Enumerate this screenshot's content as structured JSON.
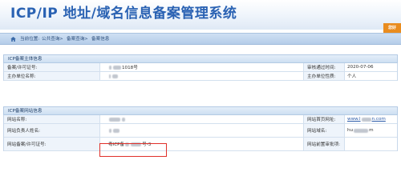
{
  "header": {
    "title": "ICP/IP 地址/域名信息备案管理系统",
    "greeting": "您好"
  },
  "breadcrumb": {
    "current_label": "当前位置:",
    "items": [
      "公共查询",
      "备案查询",
      "备案信息"
    ],
    "separator": "->"
  },
  "subject_section": {
    "title": "ICP备案主体信息",
    "rows": [
      {
        "label1": "备案/许可证号:",
        "value1": "1018号",
        "label2": "审核通过时间:",
        "value2": "2020-07-06"
      },
      {
        "label1": "主办单位名称:",
        "value1": "",
        "label2": "主办单位性质:",
        "value2": "个人"
      }
    ]
  },
  "website_section": {
    "title": "ICP备案网站信息",
    "rows": [
      {
        "label1": "网站名称:",
        "value1": "",
        "label2": "网站首页网址:",
        "value2": "www.l",
        "value2_suffix": "n.com"
      },
      {
        "label1": "网站负责人姓名:",
        "value1": "",
        "label2": "网站域名:",
        "value2": "hu",
        "value2_suffix": "m"
      },
      {
        "label1": "网站备案/许可证号:",
        "value1": "粤ICP备",
        "value1_suffix": "号-3",
        "label2": "网站前置审批项:",
        "value2": ""
      }
    ]
  },
  "colors": {
    "title_blue": "#2a62b3",
    "greeting_orange": "#e98c1f",
    "highlight_red": "#e0302a",
    "link_blue": "#2a5aa8"
  }
}
